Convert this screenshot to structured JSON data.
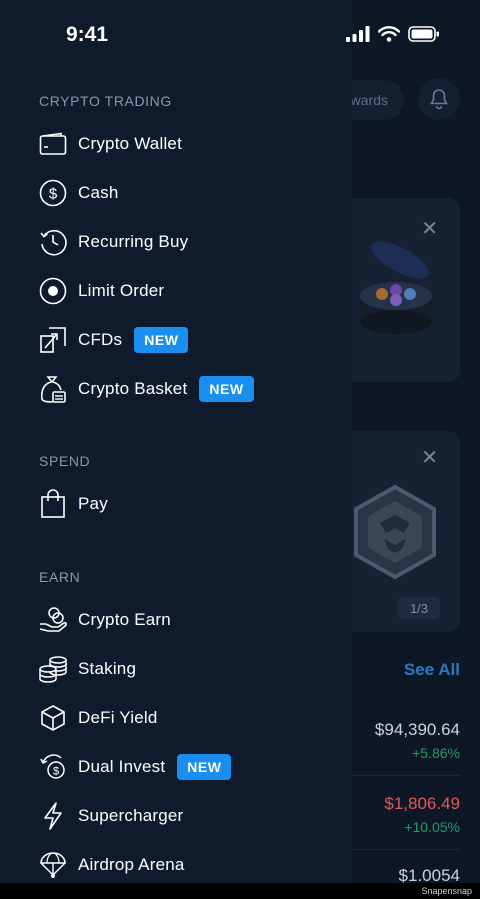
{
  "status_bar": {
    "time": "9:41"
  },
  "background": {
    "rewards_label": "wards",
    "close_glyph": "✕",
    "pager": "1/3",
    "see_all": "See All",
    "assets": [
      {
        "price": "$94,390.64",
        "change": "+5.86%",
        "change_color": "#1f9d6b"
      },
      {
        "price": "$1,806.49",
        "change": "+10.05%",
        "change_color": "#1f9d6b",
        "price_color": "#e05a5a"
      },
      {
        "price": "$1.0054"
      }
    ]
  },
  "drawer": {
    "sections": {
      "crypto_trading": "CRYPTO TRADING",
      "spend": "SPEND",
      "earn": "EARN"
    },
    "items": {
      "crypto_wallet": "Crypto Wallet",
      "cash": "Cash",
      "recurring_buy": "Recurring Buy",
      "limit_order": "Limit Order",
      "cfds": "CFDs",
      "crypto_basket": "Crypto Basket",
      "pay": "Pay",
      "crypto_earn": "Crypto Earn",
      "staking": "Staking",
      "defi_yield": "DeFi Yield",
      "dual_invest": "Dual Invest",
      "supercharger": "Supercharger",
      "airdrop_arena": "Airdrop Arena"
    },
    "badge_new": "NEW"
  },
  "watermark": "Snapensnap",
  "colors": {
    "drawer_bg": "#0f1b2d",
    "badge": "#1a8ff0",
    "section_title": "#8a97ab"
  }
}
